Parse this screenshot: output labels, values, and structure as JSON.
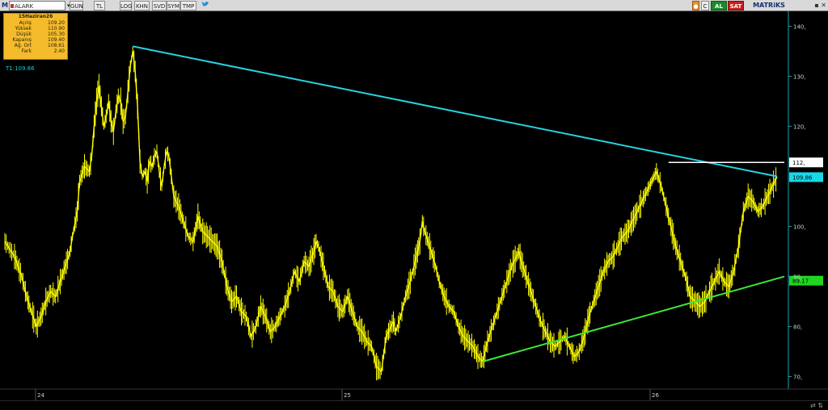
{
  "toolbar": {
    "logo": "M",
    "symbol": "ALARK",
    "period": "GUN",
    "currency": "TL",
    "log": "LOG",
    "khn": "KHN",
    "svd": "SVD",
    "sym": "SYM",
    "tmp": "TMP",
    "c_label": "C",
    "buy_label": "AL",
    "sell_label": "SAT",
    "brand": "MATRiKS"
  },
  "info_panel": {
    "date": "15Haziran26",
    "rows": [
      {
        "label": "Açılış",
        "value": "109.20"
      },
      {
        "label": "Yüksek",
        "value": "110.90"
      },
      {
        "label": "Düşük",
        "value": "105.30"
      },
      {
        "label": "Kapanış",
        "value": "109.40"
      },
      {
        "label": "Ağ. Ort",
        "value": "108.61"
      },
      {
        "label": "Fark",
        "value": "2.40"
      }
    ]
  },
  "last_value_label": "T1:109.86",
  "chart_data": {
    "type": "line",
    "series": [
      {
        "name": "ALARK",
        "color": "#ffff00"
      }
    ],
    "x_ticks": [
      "24",
      "25",
      "26"
    ],
    "y_ticks": [
      140,
      130,
      120,
      100,
      90,
      80,
      70
    ],
    "y_tick_labels": [
      "140,",
      "130,",
      "120,",
      "100,",
      "90,",
      "80,",
      "70,"
    ],
    "ylim": [
      68,
      143
    ],
    "price_path": [
      [
        0,
        97
      ],
      [
        4,
        94
      ],
      [
        7,
        90
      ],
      [
        9,
        86
      ],
      [
        11,
        83
      ],
      [
        13,
        80
      ],
      [
        15,
        82
      ],
      [
        17,
        85
      ],
      [
        19,
        87
      ],
      [
        21,
        86
      ],
      [
        23,
        89
      ],
      [
        25,
        92
      ],
      [
        27,
        95
      ],
      [
        28,
        98
      ],
      [
        30,
        103
      ],
      [
        31,
        109
      ],
      [
        33,
        112
      ],
      [
        35,
        111
      ],
      [
        36,
        114
      ],
      [
        37,
        120
      ],
      [
        38,
        125
      ],
      [
        39,
        128
      ],
      [
        40,
        124
      ],
      [
        41,
        120
      ],
      [
        42,
        122
      ],
      [
        43,
        125
      ],
      [
        44,
        121
      ],
      [
        45,
        119
      ],
      [
        46,
        123
      ],
      [
        47,
        126
      ],
      [
        48,
        125
      ],
      [
        49,
        121
      ],
      [
        50,
        122
      ],
      [
        51,
        127
      ],
      [
        52,
        132
      ],
      [
        53,
        135
      ],
      [
        54,
        131
      ],
      [
        55,
        124
      ],
      [
        56,
        113
      ],
      [
        57,
        110
      ],
      [
        58,
        111
      ],
      [
        59,
        109
      ],
      [
        60,
        113
      ],
      [
        61,
        112
      ],
      [
        62,
        114
      ],
      [
        63,
        115
      ],
      [
        64,
        111
      ],
      [
        65,
        108
      ],
      [
        66,
        112
      ],
      [
        67,
        115
      ],
      [
        68,
        114
      ],
      [
        69,
        110
      ],
      [
        70,
        106
      ],
      [
        72,
        104
      ],
      [
        74,
        101
      ],
      [
        76,
        98
      ],
      [
        78,
        97
      ],
      [
        80,
        102
      ],
      [
        82,
        99
      ],
      [
        84,
        98
      ],
      [
        86,
        97
      ],
      [
        88,
        96
      ],
      [
        90,
        93
      ],
      [
        92,
        88
      ],
      [
        94,
        85
      ],
      [
        96,
        86
      ],
      [
        98,
        83
      ],
      [
        100,
        82
      ],
      [
        102,
        78
      ],
      [
        104,
        80
      ],
      [
        106,
        84
      ],
      [
        108,
        82
      ],
      [
        110,
        79
      ],
      [
        112,
        80
      ],
      [
        114,
        82
      ],
      [
        116,
        84
      ],
      [
        118,
        87
      ],
      [
        120,
        91
      ],
      [
        122,
        89
      ],
      [
        124,
        93
      ],
      [
        126,
        92
      ],
      [
        128,
        95
      ],
      [
        129,
        97
      ],
      [
        130,
        96
      ],
      [
        132,
        92
      ],
      [
        134,
        88
      ],
      [
        136,
        87
      ],
      [
        138,
        84
      ],
      [
        140,
        83
      ],
      [
        142,
        86
      ],
      [
        144,
        83
      ],
      [
        146,
        80
      ],
      [
        148,
        79
      ],
      [
        150,
        77
      ],
      [
        152,
        76
      ],
      [
        154,
        72
      ],
      [
        156,
        71
      ],
      [
        158,
        78
      ],
      [
        160,
        80
      ],
      [
        161,
        81
      ],
      [
        162,
        79
      ],
      [
        164,
        82
      ],
      [
        166,
        86
      ],
      [
        168,
        89
      ],
      [
        170,
        93
      ],
      [
        172,
        97
      ],
      [
        173,
        101
      ],
      [
        174,
        99
      ],
      [
        176,
        96
      ],
      [
        178,
        93
      ],
      [
        180,
        89
      ],
      [
        182,
        86
      ],
      [
        184,
        84
      ],
      [
        186,
        83
      ],
      [
        188,
        80
      ],
      [
        190,
        78
      ],
      [
        192,
        77
      ],
      [
        194,
        76
      ],
      [
        196,
        74
      ],
      [
        198,
        73
      ],
      [
        200,
        77
      ],
      [
        202,
        80
      ],
      [
        204,
        83
      ],
      [
        206,
        86
      ],
      [
        208,
        89
      ],
      [
        210,
        92
      ],
      [
        212,
        94
      ],
      [
        213,
        95
      ],
      [
        214,
        93
      ],
      [
        216,
        90
      ],
      [
        218,
        87
      ],
      [
        220,
        84
      ],
      [
        222,
        81
      ],
      [
        224,
        79
      ],
      [
        226,
        77
      ],
      [
        228,
        76
      ],
      [
        230,
        77
      ],
      [
        232,
        78
      ],
      [
        234,
        76
      ],
      [
        236,
        74
      ],
      [
        238,
        75
      ],
      [
        240,
        78
      ],
      [
        242,
        82
      ],
      [
        244,
        85
      ],
      [
        246,
        88
      ],
      [
        248,
        91
      ],
      [
        250,
        93
      ],
      [
        252,
        94
      ],
      [
        254,
        96
      ],
      [
        256,
        98
      ],
      [
        258,
        99
      ],
      [
        260,
        101
      ],
      [
        262,
        103
      ],
      [
        264,
        105
      ],
      [
        266,
        107
      ],
      [
        268,
        109
      ],
      [
        270,
        111
      ],
      [
        272,
        108
      ],
      [
        274,
        104
      ],
      [
        276,
        100
      ],
      [
        278,
        96
      ],
      [
        280,
        93
      ],
      [
        282,
        90
      ],
      [
        284,
        86
      ],
      [
        286,
        85
      ],
      [
        288,
        84
      ],
      [
        290,
        85
      ],
      [
        292,
        87
      ],
      [
        294,
        89
      ],
      [
        296,
        91
      ],
      [
        298,
        89
      ],
      [
        300,
        88
      ],
      [
        302,
        91
      ],
      [
        304,
        96
      ],
      [
        306,
        103
      ],
      [
        308,
        106
      ],
      [
        310,
        105
      ],
      [
        312,
        103
      ],
      [
        314,
        104
      ],
      [
        316,
        106
      ],
      [
        318,
        108
      ],
      [
        320,
        109.9
      ]
    ],
    "price_x_max": 320,
    "resistance_line": {
      "from": [
        53,
        136
      ],
      "to": [
        320,
        110
      ]
    },
    "support_line": {
      "from": [
        198,
        73
      ],
      "to": [
        323,
        90
      ]
    },
    "horizontal_line": {
      "from": [
        275,
        112.8
      ],
      "to": [
        323,
        112.8
      ]
    },
    "colors": {
      "price": "#ffff00",
      "resistance": "#27d3e3",
      "support": "#3ee63a",
      "horizontal": "#ffffff",
      "axis": "#1aa9b5"
    },
    "markers": [
      {
        "text": "112,",
        "value": 112.8,
        "bg": "#ffffff",
        "fg": "#000000"
      },
      {
        "text": "109.86",
        "value": 109.86,
        "bg": "#19d7e8",
        "fg": "#000000"
      },
      {
        "text": "89.17",
        "value": 89.17,
        "bg": "#20d420",
        "fg": "#000000"
      }
    ]
  }
}
